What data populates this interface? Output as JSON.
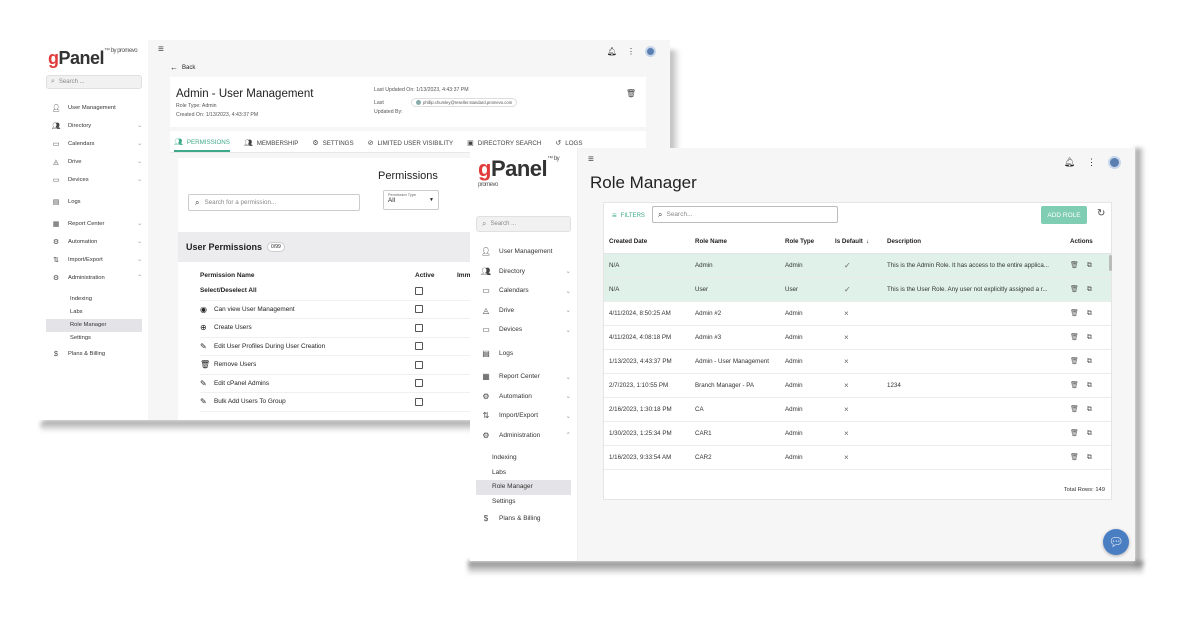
{
  "colors": {
    "accent": "#3fa98a",
    "logo_g": "#e23b3b",
    "default_row": "#dff1e9",
    "add_button": "#7fcdb3",
    "fab": "#4a7ec2"
  },
  "brand": {
    "logo_g": "g",
    "logo_rest": "Panel",
    "logo_tm": "™ by promevo"
  },
  "sidebar": {
    "search_placeholder": "Search ...",
    "items": [
      {
        "label": "User Management",
        "icon": "person-icon",
        "chevron": false
      },
      {
        "label": "Directory",
        "icon": "people-icon",
        "chevron": true
      },
      {
        "label": "Calendars",
        "icon": "calendar-icon",
        "chevron": true
      },
      {
        "label": "Drive",
        "icon": "drive-icon",
        "chevron": true
      },
      {
        "label": "Devices",
        "icon": "devices-icon",
        "chevron": true
      },
      {
        "label": "Logs",
        "icon": "logs-icon",
        "chevron": false
      },
      {
        "label": "Report Center",
        "icon": "report-icon",
        "chevron": true
      },
      {
        "label": "Automation",
        "icon": "automation-icon",
        "chevron": true
      },
      {
        "label": "Import/Export",
        "icon": "import-export-icon",
        "chevron": true
      },
      {
        "label": "Administration",
        "icon": "admin-icon",
        "chevron": true
      }
    ],
    "sub_items": [
      "Indexing",
      "Labs",
      "Role Manager",
      "Settings"
    ],
    "billing": "Plans & Billing"
  },
  "w1": {
    "back": "Back",
    "title": "Admin - User Management",
    "role_type": "Role Type: Admin",
    "created_on": "Created On: 1/13/2023, 4:43:37 PM",
    "last_updated_on": "Last Updated On: 1/13/2023, 4:43:37 PM",
    "last_updated_by_label": "Last Updated By:",
    "last_updated_by_value": "phillip.chumley@reseller.standard.promevo.com",
    "tabs": [
      "PERMISSIONS",
      "MEMBERSHIP",
      "SETTINGS",
      "LIMITED USER VISIBILITY",
      "DIRECTORY SEARCH",
      "LOGS"
    ],
    "permissions_heading": "Permissions",
    "search_permission_placeholder": "Search for a permission...",
    "permission_type_label": "Permission Type",
    "permission_type_value": "All",
    "user_permissions_title": "User Permissions",
    "user_permissions_count": "0/99",
    "col_name": "Permission Name",
    "col_active": "Active",
    "col_imm": "Imm",
    "rows": [
      {
        "label": "Select/Deselect All",
        "icon": ""
      },
      {
        "label": "Can view User Management",
        "icon": "eye-icon"
      },
      {
        "label": "Create Users",
        "icon": "plus-circle-icon"
      },
      {
        "label": "Edit User Profiles During User Creation",
        "icon": "pencil-icon"
      },
      {
        "label": "Remove Users",
        "icon": "trash-icon"
      },
      {
        "label": "Edit cPanel Admins",
        "icon": "pencil-icon"
      },
      {
        "label": "Bulk Add Users To Group",
        "icon": "pencil-icon"
      }
    ]
  },
  "w2": {
    "page_title": "Role Manager",
    "filters_label": "FILTERS",
    "search_placeholder": "Search...",
    "add_role": "ADD ROLE",
    "columns": [
      "Created Date",
      "Role Name",
      "Role Type",
      "Is Default",
      "Description",
      "Actions"
    ],
    "rows": [
      {
        "date": "N/A",
        "name": "Admin",
        "type": "Admin",
        "is_default": true,
        "desc": "This is the Admin Role. It has access to the entire applica..."
      },
      {
        "date": "N/A",
        "name": "User",
        "type": "User",
        "is_default": true,
        "desc": "This is the User Role. Any user not explicitly assigned a r..."
      },
      {
        "date": "4/11/2024, 8:50:25 AM",
        "name": "Admin #2",
        "type": "Admin",
        "is_default": false,
        "desc": ""
      },
      {
        "date": "4/11/2024, 4:08:18 PM",
        "name": "Admin #3",
        "type": "Admin",
        "is_default": false,
        "desc": ""
      },
      {
        "date": "1/13/2023, 4:43:37 PM",
        "name": "Admin - User Management",
        "type": "Admin",
        "is_default": false,
        "desc": ""
      },
      {
        "date": "2/7/2023, 1:10:55 PM",
        "name": "Branch Manager - PA",
        "type": "Admin",
        "is_default": false,
        "desc": "1234"
      },
      {
        "date": "2/16/2023, 1:30:18 PM",
        "name": "CA",
        "type": "Admin",
        "is_default": false,
        "desc": ""
      },
      {
        "date": "1/30/2023, 1:25:34 PM",
        "name": "CAR1",
        "type": "Admin",
        "is_default": false,
        "desc": ""
      },
      {
        "date": "1/16/2023, 9:33:54 AM",
        "name": "CAR2",
        "type": "Admin",
        "is_default": false,
        "desc": ""
      }
    ],
    "total_rows": "Total Rows: 149"
  }
}
